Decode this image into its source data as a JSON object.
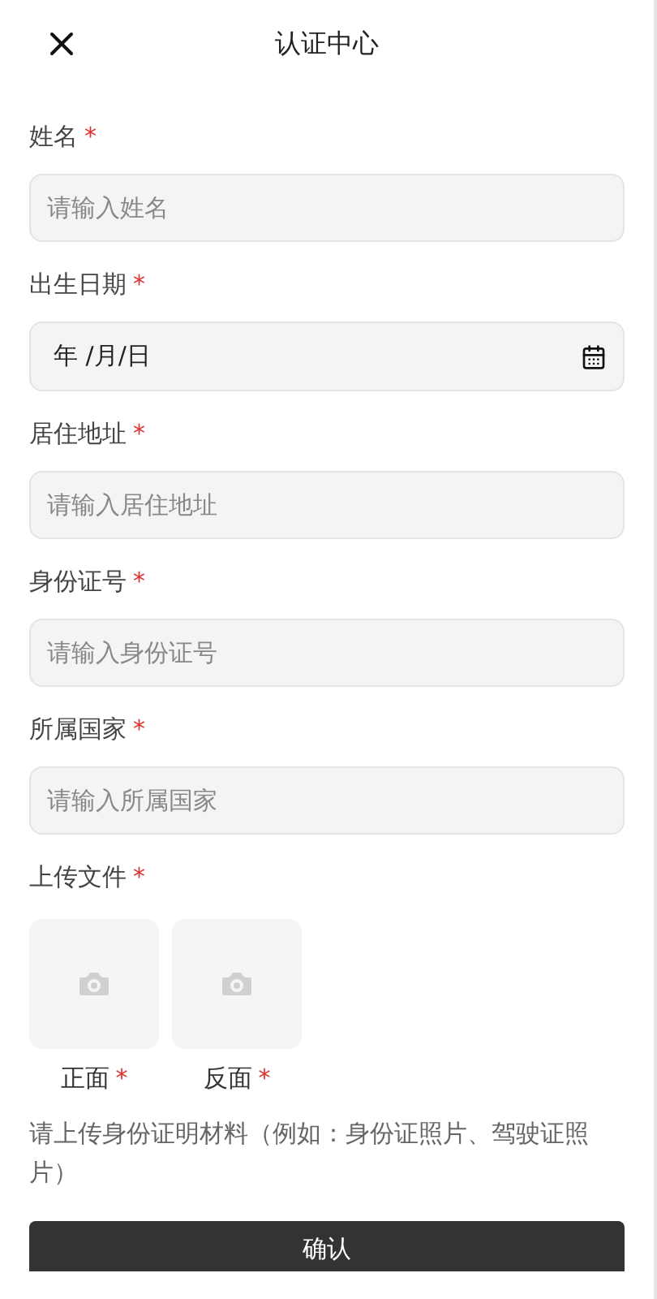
{
  "header": {
    "title": "认证中心"
  },
  "fields": [
    {
      "kind": "text",
      "label": "姓名",
      "mark": "*",
      "placeholder": "请输入姓名"
    },
    {
      "kind": "date",
      "label": "出生日期",
      "mark": "*",
      "value": "年 /月/日"
    },
    {
      "kind": "text",
      "label": "居住地址",
      "mark": "*",
      "placeholder": "请输入居住地址"
    },
    {
      "kind": "text",
      "label": "身份证号",
      "mark": "*",
      "placeholder": "请输入身份证号"
    },
    {
      "kind": "text",
      "label": "所属国家",
      "mark": "*",
      "placeholder": "请输入所属国家"
    }
  ],
  "upload": {
    "label": "上传文件",
    "mark": "*",
    "tiles": [
      {
        "caption": "正面",
        "mark": "*"
      },
      {
        "caption": "反面",
        "mark": "*"
      }
    ],
    "hint": "请上传身份证明材料（例如：身份证照片、驾驶证照片）"
  },
  "submit": "确认"
}
